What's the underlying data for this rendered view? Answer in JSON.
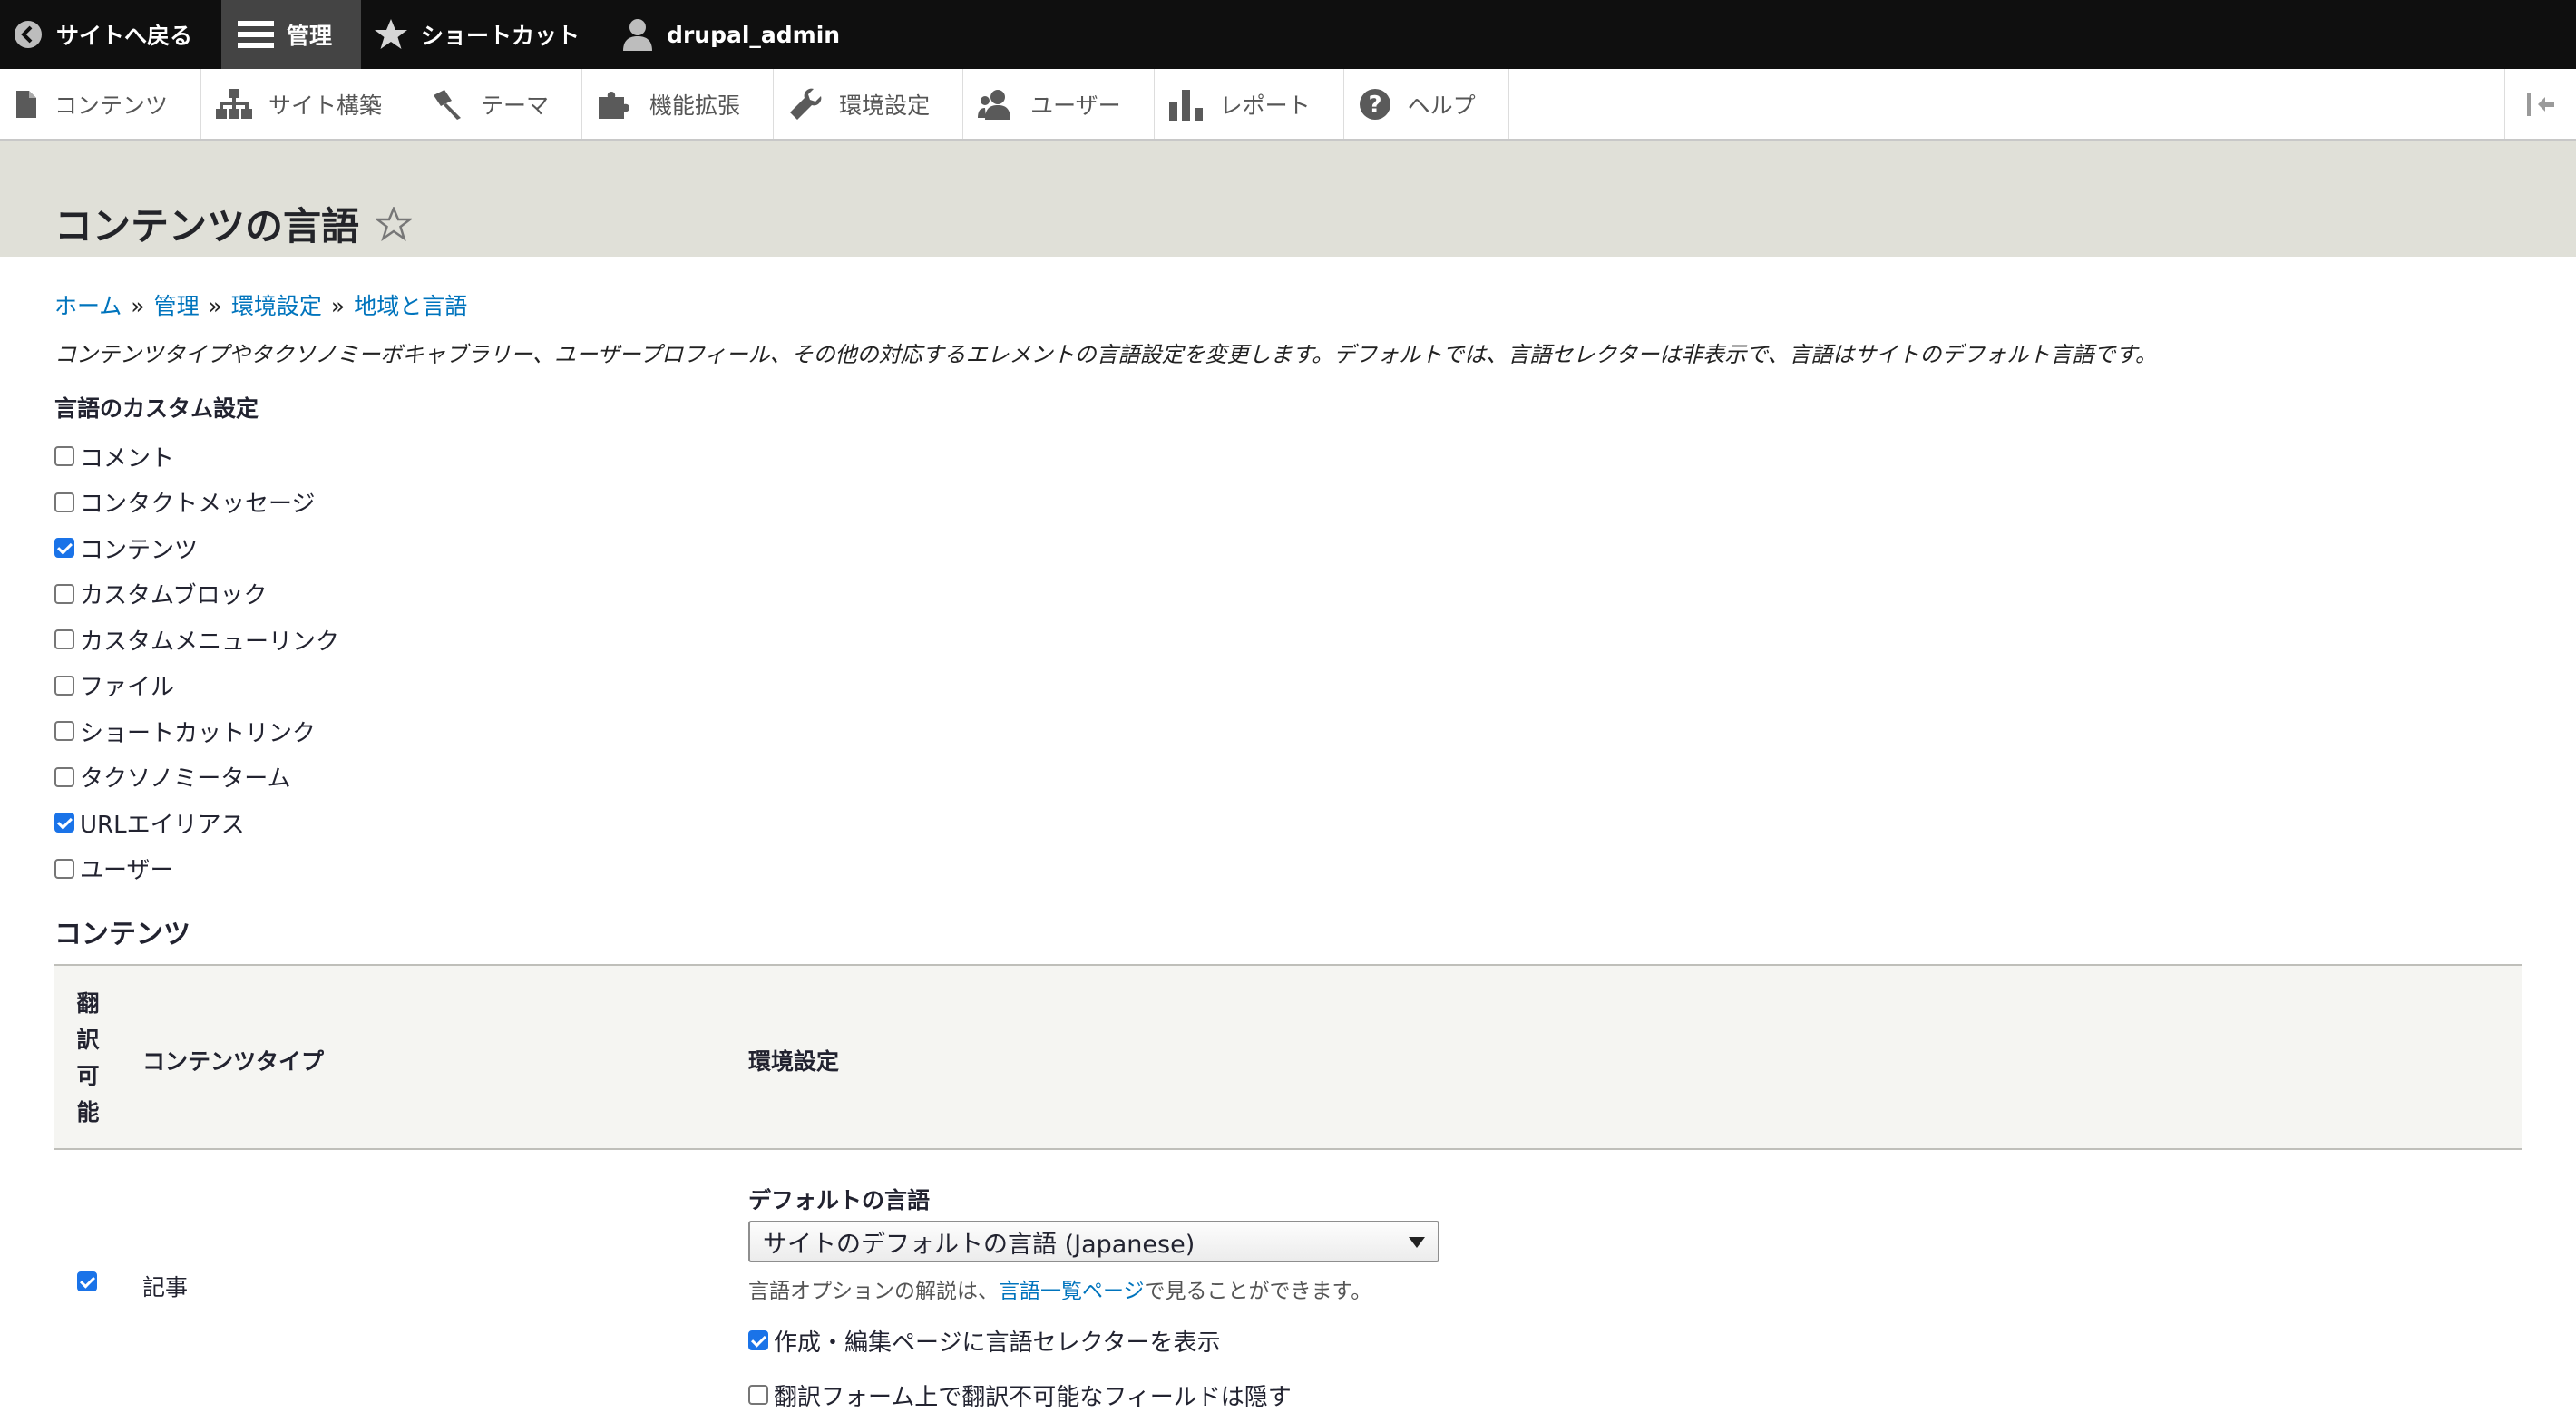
{
  "toolbar": {
    "back_label": "サイトへ戻る",
    "manage_label": "管理",
    "shortcuts_label": "ショートカット",
    "user_label": "drupal_admin"
  },
  "tray": {
    "items": [
      {
        "label": "コンテンツ",
        "icon": "file-icon"
      },
      {
        "label": "サイト構築",
        "icon": "structure-icon"
      },
      {
        "label": "テーマ",
        "icon": "paintbrush-icon"
      },
      {
        "label": "機能拡張",
        "icon": "puzzle-icon"
      },
      {
        "label": "環境設定",
        "icon": "wrench-icon"
      },
      {
        "label": "ユーザー",
        "icon": "people-icon"
      },
      {
        "label": "レポート",
        "icon": "bar-chart-icon"
      },
      {
        "label": "ヘルプ",
        "icon": "help-icon"
      }
    ]
  },
  "page": {
    "title": "コンテンツの言語",
    "breadcrumb": [
      "ホーム",
      "管理",
      "環境設定",
      "地域と言語"
    ],
    "description": "コンテンツタイプやタクソノミーボキャブラリー、ユーザープロフィール、その他の対応するエレメントの言語設定を変更します。デフォルトでは、言語セレクターは非表示で、言語はサイトのデフォルト言語です。",
    "custom_settings_label": "言語のカスタム設定",
    "custom_settings": [
      {
        "label": "コメント",
        "checked": false
      },
      {
        "label": "コンタクトメッセージ",
        "checked": false
      },
      {
        "label": "コンテンツ",
        "checked": true
      },
      {
        "label": "カスタムブロック",
        "checked": false
      },
      {
        "label": "カスタムメニューリンク",
        "checked": false
      },
      {
        "label": "ファイル",
        "checked": false
      },
      {
        "label": "ショートカットリンク",
        "checked": false
      },
      {
        "label": "タクソノミーターム",
        "checked": false
      },
      {
        "label": "URLエイリアス",
        "checked": true
      },
      {
        "label": "ユーザー",
        "checked": false
      }
    ],
    "content_heading": "コンテンツ"
  },
  "table": {
    "headers": {
      "translatable": [
        "翻",
        "訳",
        "可",
        "能"
      ],
      "content_type": "コンテンツタイプ",
      "settings": "環境設定"
    },
    "rows": [
      {
        "translatable": true,
        "content_type": "記事",
        "default_language_label": "デフォルトの言語",
        "default_language_value": "サイトのデフォルトの言語 (Japanese)",
        "help_prefix": "言語オプションの解説は、",
        "help_link": "言語一覧ページ",
        "help_suffix": "で見ることができます。",
        "options": [
          {
            "label": "作成・編集ページに言語セレクターを表示",
            "checked": true
          },
          {
            "label": "翻訳フォーム上で翻訳不可能なフィールドは隠す",
            "checked": false
          }
        ]
      }
    ]
  }
}
